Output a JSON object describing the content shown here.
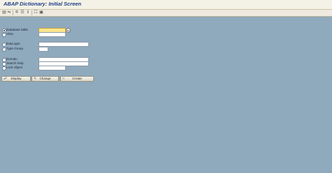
{
  "window": {
    "title": "ABAP Dictionary: Initial Screen"
  },
  "toolbar": {
    "icons": [
      "object-list-icon",
      "where-used-icon",
      "display-change-icon",
      "hierarchy-icon",
      "info-icon",
      "help-icon",
      "extras-icon"
    ]
  },
  "form": {
    "options": [
      {
        "label": "Database table",
        "selected": true
      },
      {
        "label": "View",
        "selected": false
      },
      {
        "label": "Data type",
        "selected": false
      },
      {
        "label": "Type Group",
        "selected": false
      },
      {
        "label": "Domain",
        "selected": false
      },
      {
        "label": "Search help",
        "selected": false
      },
      {
        "label": "Lock object",
        "selected": false
      }
    ],
    "value_help_label": "F4"
  },
  "buttons": {
    "display": "Display",
    "change": "Change",
    "create": "Create"
  },
  "colors": {
    "background": "#8fa9bd",
    "title_text": "#1f3d87",
    "focused_field": "#fbe58e"
  }
}
